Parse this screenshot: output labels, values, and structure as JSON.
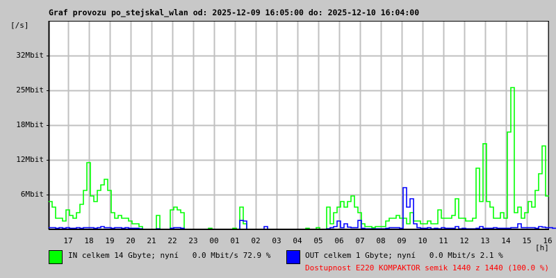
{
  "title": "Graf provozu po_stejskal_wlan od: 2025-12-09 16:05:00 do: 2025-12-10 16:04:00",
  "chart_data": {
    "type": "line",
    "title": "Graf provozu po_stejskal_wlan od: 2025-12-09 16:05:00 do: 2025-12-10 16:04:00",
    "ylabel": "[/s]",
    "xlabel": "[h]",
    "ylim": [
      0,
      37.5
    ],
    "y_unit": "Mbit/s",
    "y_ticks": [
      {
        "v": 6.25,
        "label": "6Mbit"
      },
      {
        "v": 12.5,
        "label": "12Mbit"
      },
      {
        "v": 18.75,
        "label": "18Mbit"
      },
      {
        "v": 25,
        "label": "25Mbit"
      },
      {
        "v": 31.25,
        "label": "32Mbit"
      }
    ],
    "x_start_minute_offset": 55,
    "x_ticks": [
      "17",
      "18",
      "19",
      "20",
      "21",
      "22",
      "23",
      "00",
      "01",
      "02",
      "03",
      "04",
      "05",
      "06",
      "07",
      "08",
      "09",
      "10",
      "11",
      "12",
      "13",
      "14",
      "15",
      "16"
    ],
    "x_step_minutes": 10,
    "grid": true,
    "series": [
      {
        "name": "IN",
        "color": "#00ff00",
        "values": [
          5,
          4,
          2,
          2,
          1.5,
          3.5,
          2.5,
          2,
          3,
          4.5,
          7,
          12,
          6,
          5,
          7,
          8,
          9,
          7,
          3,
          2,
          2.5,
          2,
          2,
          1.5,
          1,
          1,
          0.5,
          0,
          0,
          0,
          0,
          2.5,
          0,
          0,
          0,
          3.5,
          4,
          3.5,
          3,
          0,
          0,
          0,
          0,
          0,
          0,
          0,
          0.2,
          0,
          0,
          0,
          0,
          0,
          0,
          0.2,
          0,
          4,
          1,
          0,
          0,
          0,
          0,
          0,
          0,
          0,
          0,
          0,
          0,
          0,
          0,
          0,
          0,
          0,
          0,
          0,
          0.2,
          0,
          0,
          0.3,
          0,
          0,
          4,
          1,
          3,
          4,
          5,
          4,
          5,
          6,
          4,
          3,
          1,
          0.5,
          0.5,
          0.3,
          0.5,
          0.5,
          0.5,
          1.5,
          2,
          2,
          2.5,
          2,
          2,
          1,
          3,
          1.5,
          1.5,
          1,
          1,
          1.5,
          1,
          1,
          3.5,
          2,
          2,
          2,
          2.5,
          5.5,
          2,
          2,
          1.5,
          1.5,
          2,
          11,
          5,
          15.4,
          5,
          4,
          2,
          2,
          3,
          2,
          17.5,
          25.5,
          3,
          4,
          2,
          3,
          5,
          4,
          7,
          10,
          15,
          6
        ]
      },
      {
        "name": "OUT",
        "color": "#0000ff",
        "values": [
          0.3,
          0.3,
          0.2,
          0.3,
          0.2,
          0.3,
          0.2,
          0.2,
          0.3,
          0.2,
          0.3,
          0.3,
          0.3,
          0.2,
          0.3,
          0.5,
          0.3,
          0.3,
          0.2,
          0.3,
          0.3,
          0.2,
          0.3,
          0.2,
          0.2,
          0.2,
          0.1,
          0,
          0,
          0,
          0,
          0.1,
          0,
          0,
          0,
          0.2,
          0.3,
          0.3,
          0.2,
          0,
          0,
          0,
          0,
          0,
          0,
          0,
          0,
          0,
          0,
          0,
          0,
          0,
          0,
          0,
          0,
          1.6,
          1.5,
          0,
          0,
          0,
          0,
          0,
          0.5,
          0,
          0,
          0,
          0,
          0,
          0,
          0,
          0,
          0,
          0,
          0,
          0,
          0,
          0,
          0,
          0,
          0,
          0.1,
          0.3,
          0.5,
          1.5,
          0.3,
          1,
          0.4,
          0.3,
          0.3,
          1.6,
          0.2,
          0.1,
          0.1,
          0.1,
          0.1,
          0.1,
          0.1,
          0.2,
          0.3,
          0.3,
          0.3,
          0.2,
          7.5,
          4,
          5.5,
          1,
          0.3,
          0.2,
          0.2,
          0.3,
          0.1,
          0.2,
          0.1,
          0.3,
          0.2,
          0.2,
          0.2,
          0.5,
          0.1,
          0.2,
          0.1,
          0.1,
          0.1,
          0.2,
          0.5,
          0.2,
          0.2,
          0.2,
          0.3,
          0.2,
          0.2,
          0.2,
          0.2,
          0.3,
          0.3,
          1,
          0.3,
          0.3,
          0.3,
          0.3,
          0.2,
          0.5,
          0.4,
          0.3,
          0.3,
          0.2
        ]
      }
    ]
  },
  "legend": {
    "in": {
      "color": "#00ff00",
      "text": "IN celkem 14 Gbyte; nyní   0.0 Mbit/s 72.9 %"
    },
    "out": {
      "color": "#0000ff",
      "text": "OUT celkem 1 Gbyte; nyní   0.0 Mbit/s 2.1 %"
    },
    "availability": {
      "color": "#ff0000",
      "text": "Dostupnost E220 KOMPAKTOR semik 1440 z 1440 (100.0 %)"
    }
  }
}
